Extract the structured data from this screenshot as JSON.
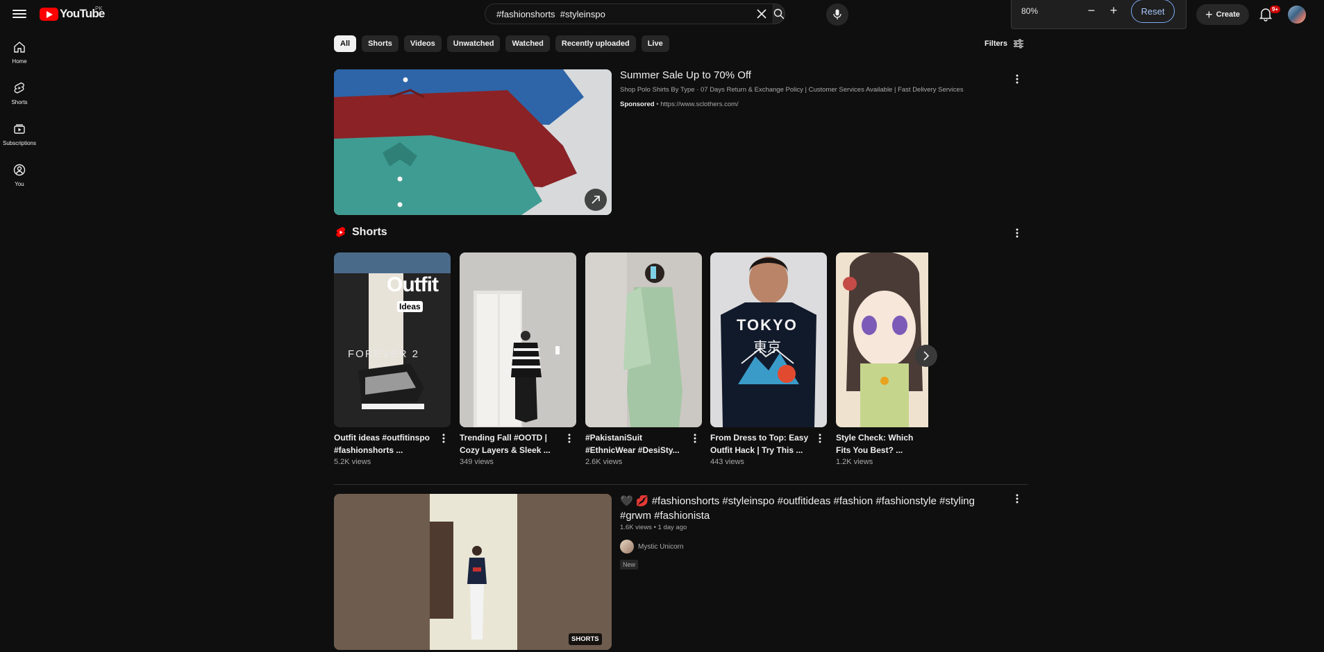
{
  "header": {
    "logo_text": "YouTube",
    "country": "PK",
    "search_value": "#fashionshorts  #styleinspo",
    "zoom_value": "80%",
    "zoom_reset": "Reset",
    "create_label": "Create",
    "notif_count": "9+"
  },
  "sidebar": {
    "items": [
      {
        "label": "Home",
        "icon": "home-icon"
      },
      {
        "label": "Shorts",
        "icon": "shorts-icon"
      },
      {
        "label": "Subscriptions",
        "icon": "subscriptions-icon"
      },
      {
        "label": "You",
        "icon": "you-icon"
      }
    ]
  },
  "chips": [
    "All",
    "Shorts",
    "Videos",
    "Unwatched",
    "Watched",
    "Recently uploaded",
    "Live"
  ],
  "filters_label": "Filters",
  "ad": {
    "title": "Summer Sale Up to 70% Off",
    "description": "Shop Polo Shirts By Type · 07 Days Return & Exchange Policy | Customer Services Available | Fast Delivery Services",
    "sponsored": "Sponsored",
    "url": " • https://www.sclothers.com/"
  },
  "shorts": {
    "heading": "Shorts",
    "items": [
      {
        "title": "Outfit ideas #outfitinspo #fashionshorts ...",
        "views": "5.2K views",
        "overlay1": "Outfit",
        "overlay2": "Ideas",
        "overlay3": "FOREVER 2"
      },
      {
        "title": "Trending Fall #OOTD | Cozy Layers & Sleek ...",
        "views": "349 views"
      },
      {
        "title": "#PakistaniSuit #EthnicWear #DesiSty...",
        "views": "2.6K views"
      },
      {
        "title": "From Dress to Top: Easy Outfit Hack | Try This ...",
        "views": "443 views",
        "overlay1": "TOKYO",
        "overlay2": "東京"
      },
      {
        "title": "Style Check: Which Fits You Best? ...",
        "views": "1.2K views"
      }
    ]
  },
  "video": {
    "title": "🖤 💋 #fashionshorts #styleinspo #outfitideas #fashion #fashionstyle #styling #grwm #fashionista",
    "meta": "1.6K views • 1 day ago",
    "channel": "Mystic Unicorn",
    "tag": "New",
    "badge": "SHORTS"
  }
}
